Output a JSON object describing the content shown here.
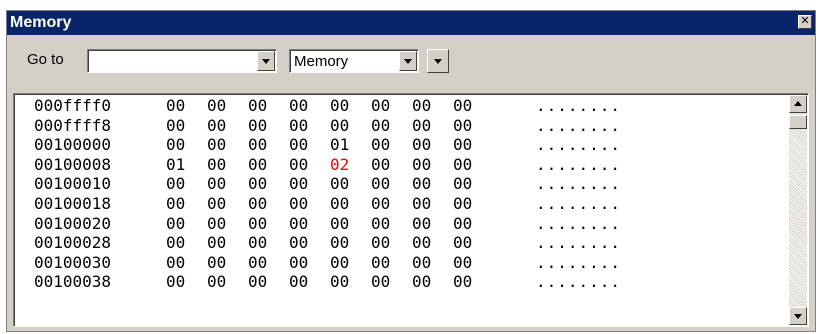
{
  "window": {
    "title": "Memory",
    "close_glyph": "✕"
  },
  "toolbar": {
    "goto_label": "Go to",
    "goto_value": "",
    "view_mode": "Memory"
  },
  "colors": {
    "titlebar": "#0a246a",
    "changed_byte": "#ff0000",
    "face": "#d4d0c8"
  },
  "dump": {
    "columns": 8,
    "rows": [
      {
        "address": "000ffff0",
        "bytes": [
          "00",
          "00",
          "00",
          "00",
          "00",
          "00",
          "00",
          "00"
        ],
        "ascii": "........",
        "changed": []
      },
      {
        "address": "000ffff8",
        "bytes": [
          "00",
          "00",
          "00",
          "00",
          "00",
          "00",
          "00",
          "00"
        ],
        "ascii": "........",
        "changed": []
      },
      {
        "address": "00100000",
        "bytes": [
          "00",
          "00",
          "00",
          "00",
          "01",
          "00",
          "00",
          "00"
        ],
        "ascii": "........",
        "changed": []
      },
      {
        "address": "00100008",
        "bytes": [
          "01",
          "00",
          "00",
          "00",
          "02",
          "00",
          "00",
          "00"
        ],
        "ascii": "........",
        "changed": [
          4
        ]
      },
      {
        "address": "00100010",
        "bytes": [
          "00",
          "00",
          "00",
          "00",
          "00",
          "00",
          "00",
          "00"
        ],
        "ascii": "........",
        "changed": []
      },
      {
        "address": "00100018",
        "bytes": [
          "00",
          "00",
          "00",
          "00",
          "00",
          "00",
          "00",
          "00"
        ],
        "ascii": "........",
        "changed": []
      },
      {
        "address": "00100020",
        "bytes": [
          "00",
          "00",
          "00",
          "00",
          "00",
          "00",
          "00",
          "00"
        ],
        "ascii": "........",
        "changed": []
      },
      {
        "address": "00100028",
        "bytes": [
          "00",
          "00",
          "00",
          "00",
          "00",
          "00",
          "00",
          "00"
        ],
        "ascii": "........",
        "changed": []
      },
      {
        "address": "00100030",
        "bytes": [
          "00",
          "00",
          "00",
          "00",
          "00",
          "00",
          "00",
          "00"
        ],
        "ascii": "........",
        "changed": []
      },
      {
        "address": "00100038",
        "bytes": [
          "00",
          "00",
          "00",
          "00",
          "00",
          "00",
          "00",
          "00"
        ],
        "ascii": "........",
        "changed": []
      }
    ]
  }
}
